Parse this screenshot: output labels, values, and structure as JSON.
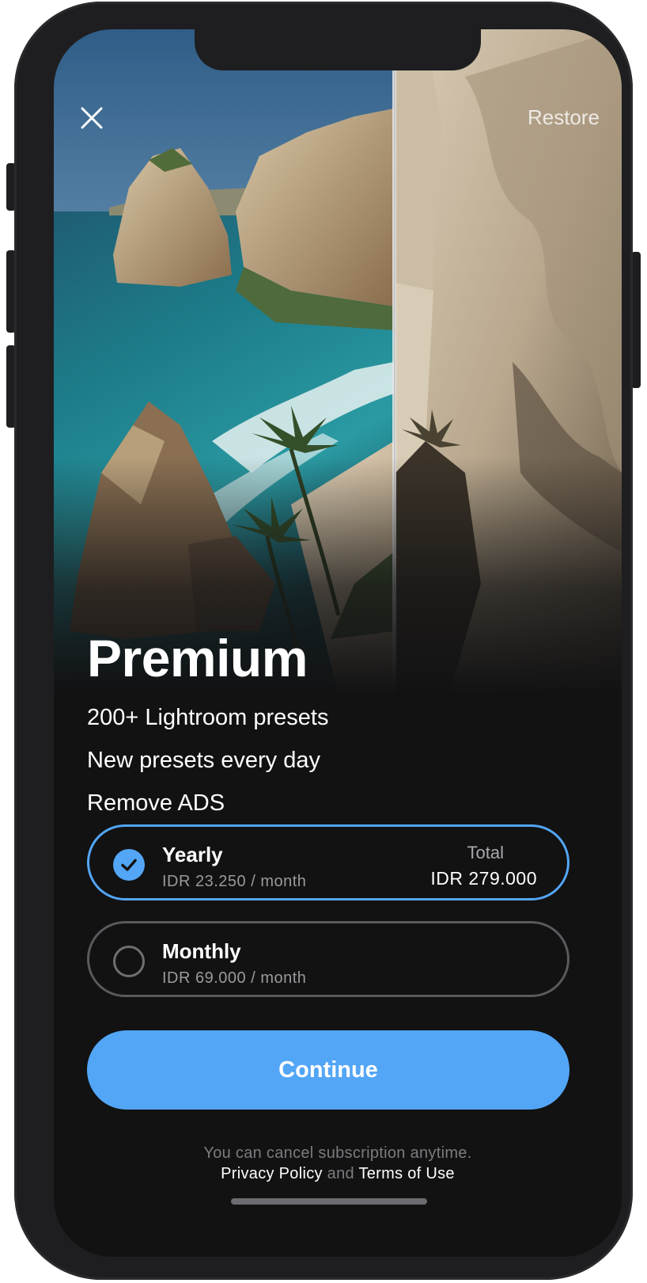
{
  "header": {
    "close_icon": "close-icon",
    "restore_label": "Restore"
  },
  "hero": {
    "title": "Premium"
  },
  "features": [
    "200+ Lightroom presets",
    "New presets every day",
    "Remove ADS"
  ],
  "plans": [
    {
      "name": "Yearly",
      "price": "IDR 23.250 / month",
      "total_label": "Total",
      "total_value": "IDR 279.000",
      "selected": true
    },
    {
      "name": "Monthly",
      "price": "IDR 69.000 / month",
      "selected": false
    }
  ],
  "continue_label": "Continue",
  "footer": {
    "note": "You can cancel subscription anytime.",
    "privacy": "Privacy Policy",
    "and": "and",
    "terms": "Terms of Use"
  },
  "colors": {
    "accent": "#53a6f6",
    "background": "#121213",
    "phone_frame": "#1e1e20"
  }
}
